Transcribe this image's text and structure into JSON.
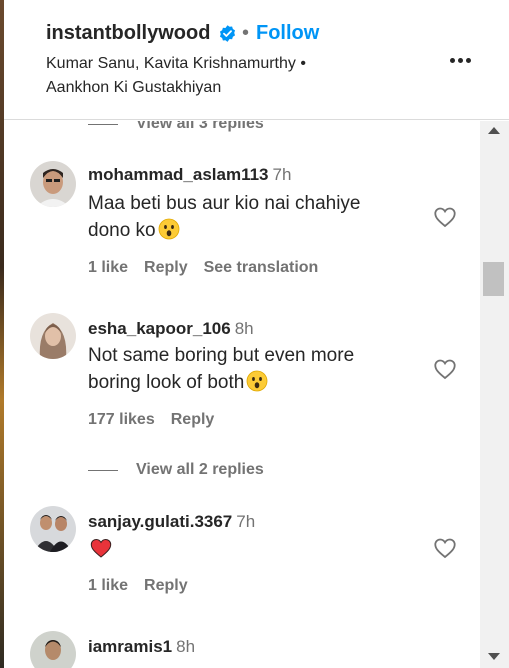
{
  "header": {
    "username": "instantbollywood",
    "separator": "•",
    "follow_label": "Follow",
    "audio_line1": "Kumar Sanu, Kavita Krishnamurthy •",
    "audio_line2": "Aankhon Ki Gustakhiyan"
  },
  "comments": {
    "top_view_replies": "View all 3 replies",
    "items": [
      {
        "username": "mohammad_aslam113",
        "time": "7h",
        "text_line1": "Maa beti bus aur kio nai chahiye",
        "text_line2": "dono ko",
        "likes": "1 like",
        "reply": "Reply",
        "translate": "See translation"
      },
      {
        "username": "esha_kapoor_106",
        "time": "8h",
        "text_line1": "Not same boring but even more",
        "text_line2": "boring look of both",
        "likes": "177 likes",
        "reply": "Reply",
        "view_replies": "View all 2 replies"
      },
      {
        "username": "sanjay.gulati.3367",
        "time": "7h",
        "likes": "1 like",
        "reply": "Reply"
      },
      {
        "username": "iamramis1",
        "time": "8h"
      }
    ]
  },
  "icons": {
    "verified": "verified-badge-icon",
    "more": "more-options-icon",
    "heart": "heart-outline-icon",
    "emoji_astonished": "astonished-face-emoji",
    "emoji_heart": "red-heart-emoji"
  },
  "colors": {
    "accent": "#0095f6",
    "text": "#262626",
    "secondary": "#737373",
    "heart_red": "#e8333a"
  }
}
